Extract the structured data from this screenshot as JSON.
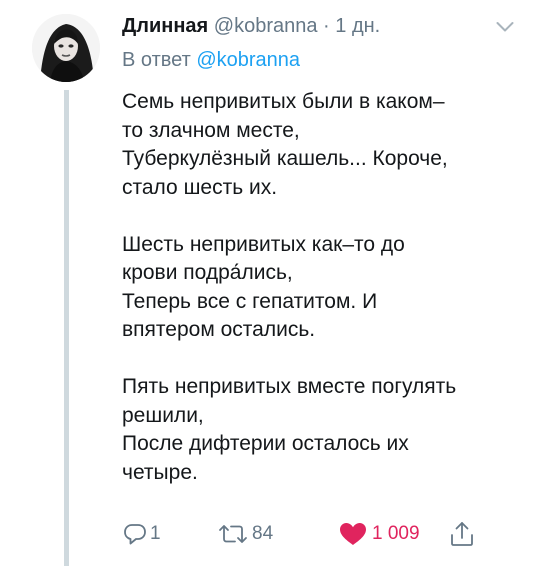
{
  "tweet": {
    "display_name": "Длинная",
    "handle": "@kobranna",
    "separator": "·",
    "timestamp": "1 дн.",
    "reply_prefix": "В ответ",
    "reply_mention": "@kobranna",
    "text_lines": [
      "Семь непривитых были в каком–",
      "то злачном месте,",
      "Туберкулёзный кашель... Короче,",
      "стало шесть их.",
      "",
      "Шесть непривитых как–то до",
      "крови подра́лись,",
      "Теперь все с гепатитом. И",
      "впятером остались.",
      "",
      "Пять непривитых вместе погулять",
      "решили,",
      "После дифтерии осталось их",
      "четыре."
    ]
  },
  "actions": {
    "reply": {
      "icon": "reply-icon",
      "count": "1"
    },
    "retweet": {
      "icon": "retweet-icon",
      "count": "84"
    },
    "like": {
      "icon": "heart-icon",
      "count": "1 009",
      "liked": true
    },
    "share": {
      "icon": "share-icon"
    }
  },
  "colors": {
    "text": "#14171a",
    "muted": "#657786",
    "link": "#1da1f2",
    "like": "#e0245e",
    "thread_line": "#cfd9de"
  }
}
